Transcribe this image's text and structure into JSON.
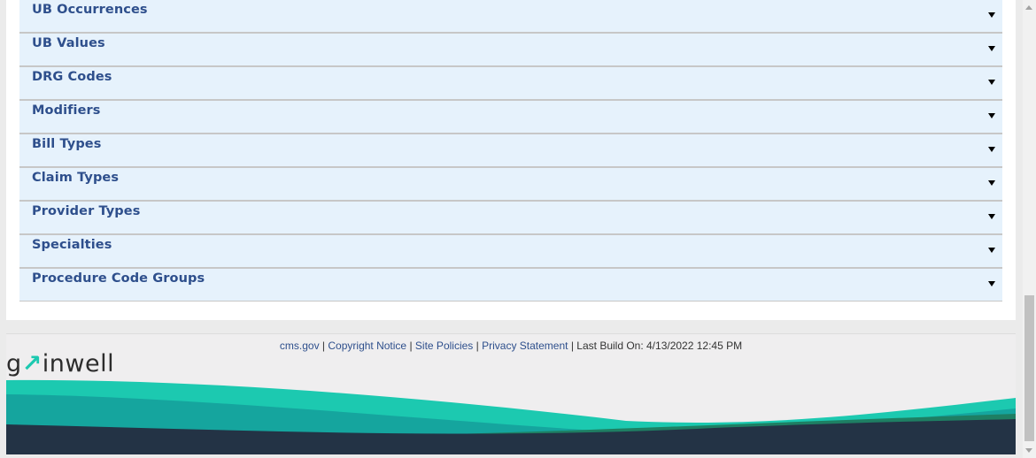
{
  "accordion": {
    "items": [
      {
        "label": "UB Occurrences"
      },
      {
        "label": "UB Values"
      },
      {
        "label": "DRG Codes"
      },
      {
        "label": "Modifiers"
      },
      {
        "label": "Bill Types"
      },
      {
        "label": "Claim Types"
      },
      {
        "label": "Provider Types"
      },
      {
        "label": "Specialties"
      },
      {
        "label": "Procedure Code Groups"
      }
    ]
  },
  "footer": {
    "links": {
      "cms": "cms.gov",
      "copyright": "Copyright Notice",
      "site_policies": "Site Policies",
      "privacy": "Privacy Statement"
    },
    "separator": "|",
    "build": "Last Build On: 4/13/2022 12:45 PM",
    "logo": {
      "pre": "g",
      "arrow": "↗",
      "post": "inwell"
    }
  },
  "colors": {
    "accordion_bg": "#e6f2fc",
    "accordion_text": "#2e4f8c",
    "teal_light": "#1cc9b0",
    "teal_mid": "#15a59e",
    "green_dark": "#1e7f63",
    "navy": "#233345"
  }
}
